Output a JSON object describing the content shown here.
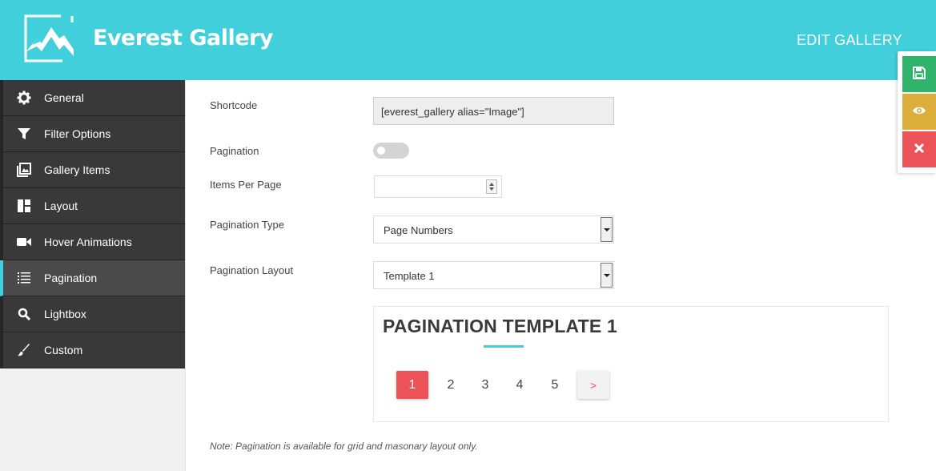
{
  "header": {
    "brand": "Everest Gallery",
    "page_title": "EDIT GALLERY",
    "accent_color": "#42cfdc"
  },
  "sidebar": {
    "items": [
      {
        "label": "General",
        "icon": "gear-icon"
      },
      {
        "label": "Filter Options",
        "icon": "filter-icon"
      },
      {
        "label": "Gallery Items",
        "icon": "gallery-icon"
      },
      {
        "label": "Layout",
        "icon": "layout-icon"
      },
      {
        "label": "Hover Animations",
        "icon": "video-camera-icon"
      },
      {
        "label": "Pagination",
        "icon": "list-icon",
        "active": true
      },
      {
        "label": "Lightbox",
        "icon": "search-icon"
      },
      {
        "label": "Custom",
        "icon": "brush-icon"
      }
    ]
  },
  "form": {
    "shortcode": {
      "label": "Shortcode",
      "value": "[everest_gallery alias=\"Image\"]"
    },
    "pagination": {
      "label": "Pagination",
      "enabled": false
    },
    "items_per_page": {
      "label": "Items Per Page",
      "value": ""
    },
    "pagination_type": {
      "label": "Pagination Type",
      "value": "Page Numbers"
    },
    "pagination_layout": {
      "label": "Pagination Layout",
      "value": "Template 1"
    }
  },
  "preview": {
    "title": "PAGINATION TEMPLATE 1",
    "pages": [
      "1",
      "2",
      "3",
      "4",
      "5"
    ],
    "current_page": "1",
    "next_label": ">"
  },
  "note": "Note: Pagination is available for grid and masonary layout only.",
  "actions": [
    {
      "icon": "save-icon",
      "color": "#2fb36a"
    },
    {
      "icon": "eye-icon",
      "color": "#dcae3c"
    },
    {
      "icon": "close-icon",
      "color": "#ec5358"
    }
  ]
}
